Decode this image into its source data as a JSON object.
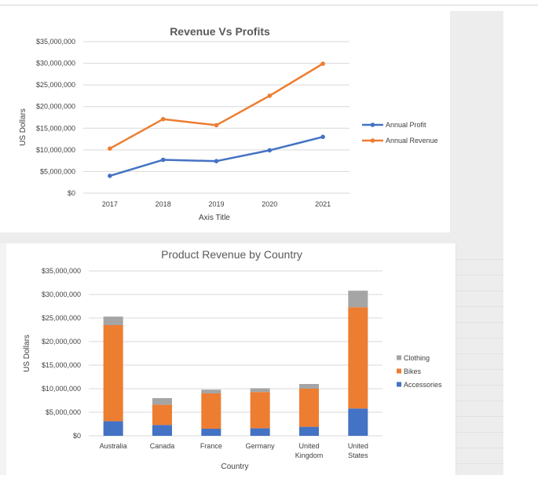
{
  "chart_data": [
    {
      "type": "line",
      "title": "Revenue Vs Profits",
      "xlabel": "Axis Title",
      "ylabel": "US Dollars",
      "categories": [
        "2017",
        "2018",
        "2019",
        "2020",
        "2021"
      ],
      "ylim": [
        0,
        35000000
      ],
      "y_ticks": [
        "$0",
        "$5,000,000",
        "$10,000,000",
        "$15,000,000",
        "$20,000,000",
        "$25,000,000",
        "$30,000,000",
        "$35,000,000"
      ],
      "grid": true,
      "legend_position": "right",
      "series": [
        {
          "name": "Annual Profit",
          "color": "#4472c4",
          "values": [
            4000000,
            7700000,
            7400000,
            9900000,
            13000000
          ]
        },
        {
          "name": "Annual Revenue",
          "color": "#ed7d31",
          "values": [
            10300000,
            17100000,
            15700000,
            22500000,
            29900000
          ]
        }
      ]
    },
    {
      "type": "bar",
      "stacked": true,
      "title": "Product Revenue by Country",
      "xlabel": "Country",
      "ylabel": "US Dollars",
      "categories": [
        "Australia",
        "Canada",
        "France",
        "Germany",
        "United Kingdom",
        "United States"
      ],
      "category_lines": [
        [
          "Australia"
        ],
        [
          "Canada"
        ],
        [
          "France"
        ],
        [
          "Germany"
        ],
        [
          "United",
          "Kingdom"
        ],
        [
          "United",
          "States"
        ]
      ],
      "ylim": [
        0,
        35000000
      ],
      "y_ticks": [
        "$0",
        "$5,000,000",
        "$10,000,000",
        "$15,000,000",
        "$20,000,000",
        "$25,000,000",
        "$30,000,000",
        "$35,000,000"
      ],
      "grid": true,
      "legend_position": "right",
      "series": [
        {
          "name": "Accessories",
          "color": "#4472c4",
          "values": [
            3100000,
            2300000,
            1500000,
            1600000,
            1900000,
            5800000
          ]
        },
        {
          "name": "Bikes",
          "color": "#ed7d31",
          "values": [
            20400000,
            4300000,
            7500000,
            7700000,
            8100000,
            21500000
          ]
        },
        {
          "name": "Clothing",
          "color": "#a5a5a5",
          "values": [
            1800000,
            1400000,
            800000,
            800000,
            1000000,
            3500000
          ]
        }
      ]
    }
  ]
}
